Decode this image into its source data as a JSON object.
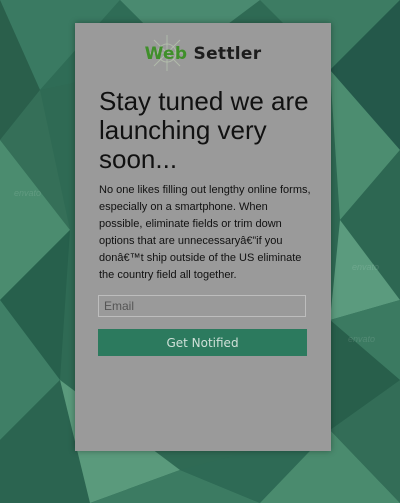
{
  "brand": {
    "name_part1": "Web",
    "name_part2": "Settler",
    "accent_color": "#3f8f2a"
  },
  "hero": {
    "headline": "Stay tuned we are launching very soon...",
    "body": "No one likes filling out lengthy online forms, especially on a smartphone. When possible, eliminate fields or trim down options that are unnecessaryâ€”if you donâ€™t ship outside of the US eliminate the country field all together."
  },
  "form": {
    "email_placeholder": "Email",
    "email_value": "",
    "submit_label": "Get Notified",
    "submit_color": "#2c7a5e"
  },
  "colors": {
    "background": "#2f6a54",
    "card": "#9a9a9a"
  }
}
